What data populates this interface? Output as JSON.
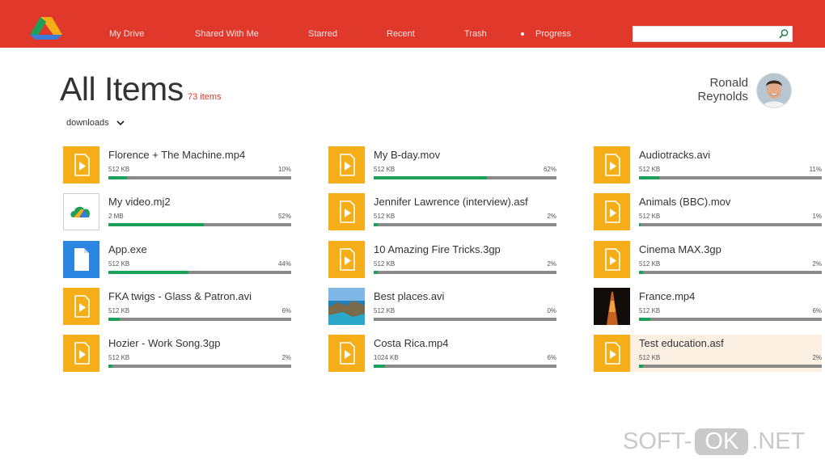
{
  "nav": {
    "items": [
      "My Drive",
      "Shared With Me",
      "Starred",
      "Recent",
      "Trash",
      "Progress"
    ]
  },
  "search": {
    "value": "",
    "placeholder": ""
  },
  "header": {
    "title": "All Items",
    "count": "73 items",
    "filter": "downloads"
  },
  "user": {
    "first_name": "Ronald",
    "last_name": "Reynolds"
  },
  "colors": {
    "accent": "#e0392c",
    "file_tile": "#f6ae18",
    "progress": "#1da05a",
    "track": "#8a8a8a",
    "selected_row": "#fbf0e2"
  },
  "files": [
    {
      "name": "Florence + The Machine.mp4",
      "size": "512 KB",
      "percent": "10%",
      "progress": 0.1,
      "icon": "video-file-icon"
    },
    {
      "name": "My video.mj2",
      "size": "2 MB",
      "percent": "52%",
      "progress": 0.52,
      "icon": "google-drive-icon"
    },
    {
      "name": "App.exe",
      "size": "512 KB",
      "percent": "44%",
      "progress": 0.44,
      "icon": "document-icon"
    },
    {
      "name": "FKA twigs - Glass & Patron.avi",
      "size": "512 KB",
      "percent": "6%",
      "progress": 0.06,
      "icon": "video-file-icon"
    },
    {
      "name": "Hozier - Work Song.3gp",
      "size": "512 KB",
      "percent": "2%",
      "progress": 0.02,
      "icon": "video-file-icon"
    },
    {
      "name": "My B-day.mov",
      "size": "512 KB",
      "percent": "62%",
      "progress": 0.62,
      "icon": "video-file-icon"
    },
    {
      "name": "Jennifer Lawrence (interview).asf",
      "size": "512 KB",
      "percent": "2%",
      "progress": 0.02,
      "icon": "video-file-icon"
    },
    {
      "name": "10 Amazing Fire Tricks.3gp",
      "size": "512 KB",
      "percent": "2%",
      "progress": 0.02,
      "icon": "video-file-icon"
    },
    {
      "name": "Best places.avi",
      "size": "512 KB",
      "percent": "0%",
      "progress": 0.0,
      "icon": "coast-photo-thumbnail"
    },
    {
      "name": "Costa Rica.mp4",
      "size": "1024 KB",
      "percent": "6%",
      "progress": 0.06,
      "icon": "video-file-icon"
    },
    {
      "name": "Audiotracks.avi",
      "size": "512 KB",
      "percent": "11%",
      "progress": 0.11,
      "icon": "video-file-icon"
    },
    {
      "name": "Animals (BBC).mov",
      "size": "512 KB",
      "percent": "1%",
      "progress": 0.01,
      "icon": "video-file-icon"
    },
    {
      "name": "Cinema MAX.3gp",
      "size": "512 KB",
      "percent": "2%",
      "progress": 0.02,
      "icon": "video-file-icon"
    },
    {
      "name": "France.mp4",
      "size": "512 KB",
      "percent": "6%",
      "progress": 0.06,
      "icon": "eiffel-tower-photo-thumbnail"
    },
    {
      "name": "Test education.asf",
      "size": "512 KB",
      "percent": "2%",
      "progress": 0.02,
      "icon": "video-file-icon",
      "selected": true
    }
  ],
  "watermark": {
    "left": "SOFT-",
    "middle": "OK",
    "right": ".NET"
  }
}
